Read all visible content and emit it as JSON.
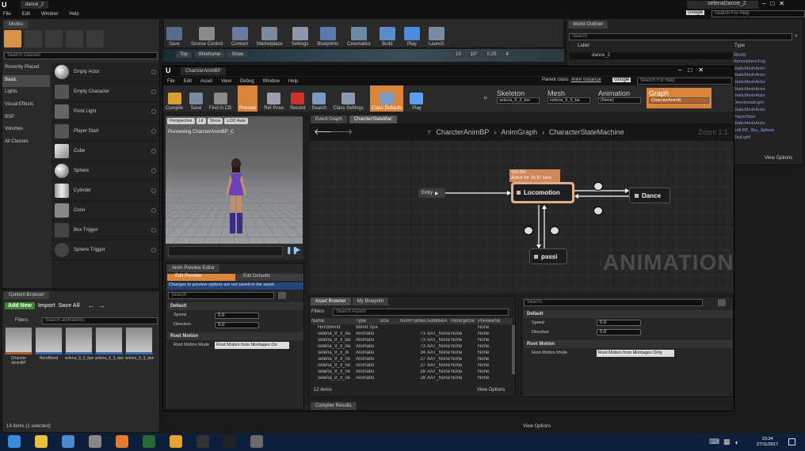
{
  "titlebar": {
    "tab": "dance_2",
    "project": "selenaDance_2",
    "search_placeholder": "Search For Help",
    "google_label": "Google"
  },
  "main_menu": [
    "File",
    "Edit",
    "Window",
    "Help"
  ],
  "modes": {
    "tab": "Modes",
    "search_placeholder": "Search Classes",
    "categories": [
      "Recently Placed",
      "Basic",
      "Lights",
      "Visual Effects",
      "BSP",
      "Volumes",
      "All Classes"
    ],
    "selected_category": "Basic",
    "items": [
      {
        "label": "Empty Actor",
        "icon": "sphere-icon"
      },
      {
        "label": "Empty Character",
        "icon": "character-icon"
      },
      {
        "label": "Point Light",
        "icon": "light-icon"
      },
      {
        "label": "Player Start",
        "icon": "player-start-icon"
      },
      {
        "label": "Cube",
        "icon": "cube-icon"
      },
      {
        "label": "Sphere",
        "icon": "sphere-icon"
      },
      {
        "label": "Cylinder",
        "icon": "cylinder-icon"
      },
      {
        "label": "Cone",
        "icon": "cone-icon"
      },
      {
        "label": "Box Trigger",
        "icon": "box-trigger-icon"
      },
      {
        "label": "Sphere Trigger",
        "icon": "sphere-trigger-icon"
      }
    ]
  },
  "level_toolbar": [
    "Save",
    "Source Control",
    "Content",
    "Marketplace",
    "Settings",
    "Blueprints",
    "Cinematics",
    "Build",
    "Play",
    "Launch"
  ],
  "viewport_bar": {
    "top": "Top",
    "wireframe": "Wireframe",
    "show": "Show",
    "v1": "10",
    "v2": "10°",
    "v3": "0.25",
    "v4": "4"
  },
  "world_outliner": {
    "tab": "World Outliner",
    "search_placeholder": "Search",
    "col_label": "Label",
    "col_type": "Type",
    "root": "dance_2",
    "root_type": "World",
    "types": [
      "AtmosphericFog",
      "StaticMeshActor",
      "StaticMeshActor",
      "StaticMeshActor",
      "StaticMeshActor",
      "StaticMeshActor",
      "DirectionalLight",
      "StaticMeshActor",
      "PlayerStart",
      "StaticMeshActor",
      "Edit BP_Sky_Sphere",
      "SkyLight"
    ],
    "view_options": "View Options"
  },
  "content_browser": {
    "tab": "Content Browser",
    "add_new": "Add New",
    "import": "Import",
    "save_all": "Save All",
    "filters": "Filters",
    "search_placeholder": "Search animations",
    "assets": [
      {
        "label": "Charcter AnimBP",
        "kind": "animbp"
      },
      {
        "label": "HeroBlend",
        "kind": "blend"
      },
      {
        "label": "selena_9_3_dance_gef_",
        "kind": "anim"
      },
      {
        "label": "selena_9_3_dance_gef_2",
        "kind": "anim"
      },
      {
        "label": "selena_9_3_dance_gef_3",
        "kind": "anim"
      }
    ],
    "status": "13 items (1 selected)",
    "view_options": "View Options"
  },
  "anim_bp": {
    "title": "CharcterAnimBP",
    "menu": [
      "File",
      "Edit",
      "Asset",
      "View",
      "Debug",
      "Window",
      "Help"
    ],
    "parent_class_label": "Parent class:",
    "parent_class": "Anim Instance",
    "search_placeholder": "Search For Help",
    "google_label": "Google",
    "toolbar": [
      "Compile",
      "Save",
      "Find in CB",
      "Preview",
      "Ref Pose",
      "Record",
      "Search",
      "Class Settings",
      "Class Defaults",
      "Play"
    ],
    "modes": [
      {
        "label": "Skeleton",
        "value": "selena_9_3_bai"
      },
      {
        "label": "Mesh",
        "value": "selena_9_3_ba"
      },
      {
        "label": "Animation",
        "value": "(None)"
      },
      {
        "label": "Graph",
        "value": "CharcterAnimB"
      }
    ]
  },
  "preview": {
    "buttons": [
      "Perspective",
      "Lit",
      "Show",
      "LOD Auto"
    ],
    "caption": "Previewing CharcterAnimBP_C"
  },
  "graph": {
    "tabs": [
      "Event Graph",
      "CharcterStateMac"
    ],
    "breadcrumb": [
      "CharcterAnimBP",
      "AnimGraph",
      "CharacterStateMachine"
    ],
    "zoom": "Zoom 1:1",
    "watermark": "ANIMATION",
    "entry": "Entry",
    "locomotion": "Locomotion",
    "dance": "Dance",
    "passi": "passi",
    "active_line1": "100.0%",
    "active_line2": "Active for 10.37 secs"
  },
  "preview_editor": {
    "tab": "Anim Preview Editor",
    "edit_preview": "Edit Preview",
    "edit_defaults": "Edit Defaults",
    "notice": "Changes to preview options are not saved in the asset.",
    "search_placeholder": "Search",
    "default_header": "Default",
    "speed_label": "Speed",
    "speed_value": "0.0",
    "direction_label": "Direction",
    "direction_value": "0.0",
    "root_motion_header": "Root Motion",
    "root_motion_label": "Root Motion Mode",
    "root_motion_value": "Root Motion from Montages On"
  },
  "asset_browser": {
    "tabs": [
      "Asset Browser",
      "My Blueprint"
    ],
    "filters": "Filters",
    "search_placeholder": "Search Assets",
    "columns": [
      "Name",
      "Type",
      "Size",
      "NumFrames",
      "AdditiveA",
      "RetargetSk",
      "PreviewSk"
    ],
    "rows": [
      [
        "HeroBlend",
        "Blend Spa",
        "",
        "",
        "",
        "",
        "None"
      ],
      [
        "selena_9_3_da",
        "Animatio",
        "",
        "73",
        "AAT_None",
        "None",
        "None"
      ],
      [
        "selena_9_3_da",
        "Animatio",
        "",
        "73",
        "AAT_None",
        "None",
        "None"
      ],
      [
        "selena_9_3_da",
        "Animatio",
        "",
        "73",
        "AAT_None",
        "None",
        "None"
      ],
      [
        "selena_9_3_di",
        "Animatio",
        "",
        "34",
        "AAT_None",
        "None",
        "None"
      ],
      [
        "selena_9_3_ne",
        "Animatio",
        "",
        "27",
        "AAT_None",
        "None",
        "None"
      ],
      [
        "selena_9_3_ne",
        "Animatio",
        "",
        "27",
        "AAT_None",
        "None",
        "None"
      ],
      [
        "selena_9_3_ne",
        "Animatio",
        "",
        "28",
        "AAT_None",
        "None",
        "None"
      ],
      [
        "selena_9_3_ne",
        "Animatio",
        "",
        "28",
        "AAT_None",
        "None",
        "None"
      ]
    ],
    "status": "12 items",
    "view_options": "View Options"
  },
  "details": {
    "search_placeholder": "Search",
    "default_header": "Default",
    "speed_label": "Speed",
    "speed_value": "0.0",
    "direction_label": "Direction",
    "direction_value": "0.0",
    "root_motion_header": "Root Motion",
    "root_motion_label": "Root Motion Mode",
    "root_motion_value": "Root Motion from Montages Only"
  },
  "compiler_tab": "Compiler Results",
  "taskbar": {
    "time": "23:34",
    "date": "27/11/2017"
  },
  "colors": {
    "accent_orange": "#d8843a",
    "graph_bg": "#262626",
    "taskbar": "#0e1f3c"
  }
}
